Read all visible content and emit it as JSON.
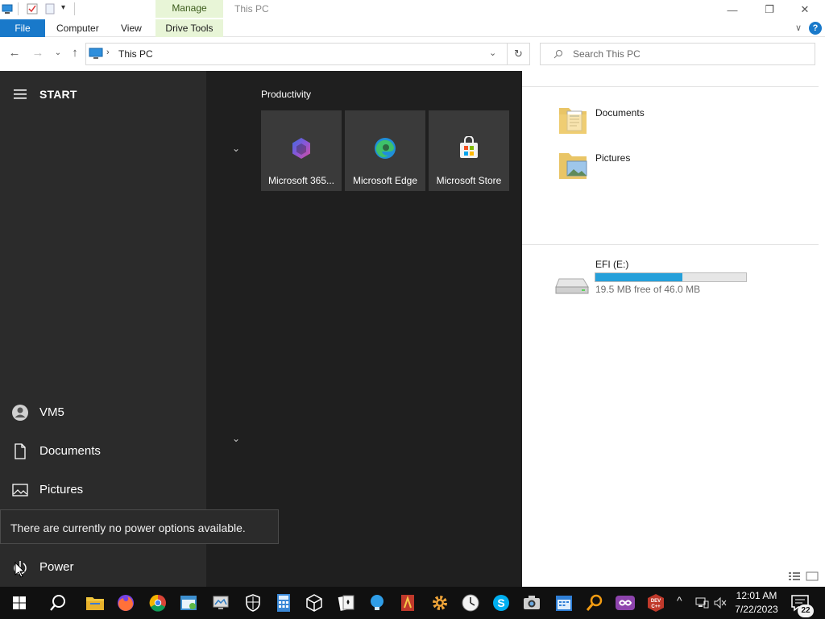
{
  "titlebar": {
    "contextual_tab": "Manage",
    "window_title": "This PC"
  },
  "ribbon": {
    "tabs": [
      "File",
      "Computer",
      "View",
      "Drive Tools"
    ],
    "help": "?"
  },
  "address": {
    "path": "This PC",
    "search_placeholder": "Search This PC"
  },
  "content": {
    "folders": [
      {
        "name": "Documents"
      },
      {
        "name": "Pictures"
      }
    ],
    "drives": [
      {
        "name": "EFI (E:)",
        "free_text": "19.5 MB free of 46.0 MB",
        "used_fraction": 0.58
      }
    ]
  },
  "start": {
    "title": "START",
    "group_title": "Productivity",
    "tiles": [
      {
        "label": "Microsoft 365..."
      },
      {
        "label": "Microsoft Edge"
      },
      {
        "label": "Microsoft Store"
      }
    ],
    "items": [
      {
        "label": "VM5"
      },
      {
        "label": "Documents"
      },
      {
        "label": "Pictures"
      },
      {
        "label": "Power"
      }
    ],
    "power_tooltip": "There are currently no power options available."
  },
  "taskbar": {
    "time": "12:01 AM",
    "date": "7/22/2023",
    "notification_count": "22",
    "apps": [
      "start-button",
      "search",
      "file-explorer",
      "firefox",
      "chrome",
      "app-generic",
      "app-generic",
      "security",
      "calculator",
      "3d-box",
      "solitaire",
      "bulb",
      "app-red",
      "settings",
      "clock-app",
      "skype",
      "camera",
      "calendar",
      "magnifier",
      "visual-studio",
      "dev-cpp"
    ]
  },
  "colors": {
    "accent": "#1979ca",
    "start_left": "#2b2b2b",
    "start_right": "#1f1f1f",
    "tile": "#3a3a3a",
    "drive_fill": "#26a0da"
  }
}
